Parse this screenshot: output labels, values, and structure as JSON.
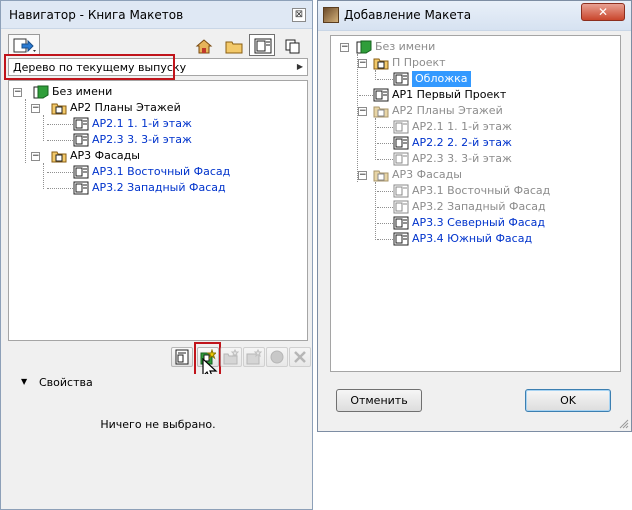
{
  "navigator": {
    "title": "Навигатор - Книга Макетов",
    "close_glyph": "⊠",
    "view_selector": "Дерево по текущему выпуску",
    "tree": [
      {
        "label": "Без имени",
        "color": "black"
      },
      {
        "label": "АР2 Планы Этажей",
        "color": "black"
      },
      {
        "label": "АР2.1 1. 1-й этаж",
        "color": "blue"
      },
      {
        "label": "АР2.3 3. 3-й этаж",
        "color": "blue"
      },
      {
        "label": "АР3 Фасады",
        "color": "black"
      },
      {
        "label": "АР3.1 Восточный Фасад",
        "color": "blue"
      },
      {
        "label": "АР3.2 Западный Фасад",
        "color": "blue"
      }
    ],
    "properties": {
      "section_label": "Свойства",
      "empty_text": "Ничего не выбрано."
    }
  },
  "dialog": {
    "title": "Добавление Макета",
    "close_glyph": "✕",
    "tree": [
      {
        "label": "Без имени",
        "color": "gray"
      },
      {
        "label": "П Проект",
        "color": "gray"
      },
      {
        "label": "Обложка",
        "color": "selected"
      },
      {
        "label": "АР1 Первый Проект",
        "color": "black"
      },
      {
        "label": "АР2 Планы Этажей",
        "color": "gray"
      },
      {
        "label": "АР2.1 1. 1-й этаж",
        "color": "gray"
      },
      {
        "label": "АР2.2 2. 2-й этаж",
        "color": "blue"
      },
      {
        "label": "АР2.3 3. 3-й этаж",
        "color": "gray"
      },
      {
        "label": "АР3 Фасады",
        "color": "gray"
      },
      {
        "label": "АР3.1 Восточный Фасад",
        "color": "gray"
      },
      {
        "label": "АР3.2 Западный Фасад",
        "color": "gray"
      },
      {
        "label": "АР3.3 Северный Фасад",
        "color": "blue"
      },
      {
        "label": "АР3.4 Южный Фасад",
        "color": "blue"
      }
    ],
    "cancel_label": "Отменить",
    "ok_label": "OK"
  },
  "colors": {
    "link_blue": "#0033cc",
    "disabled_gray": "#8c8c8c",
    "selection": "#3399ff",
    "highlight_red": "#c0141b"
  },
  "icons": [
    "publisher-icon",
    "project-map-icon",
    "view-map-icon",
    "layout-book-icon",
    "publisher-sets-icon",
    "layout-icon",
    "subset-folder-icon",
    "project-root-icon",
    "new-layout-icon",
    "new-subset-icon",
    "new-master-icon",
    "settings-icon",
    "delete-icon",
    "mouse-cursor-icon"
  ]
}
